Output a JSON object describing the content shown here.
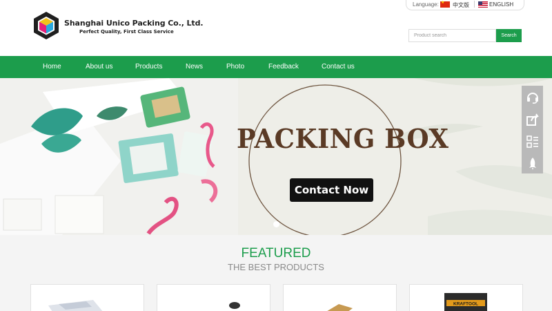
{
  "header": {
    "company_name": "Shanghai Unico Packing Co., Ltd.",
    "slogan": "Perfect Quality, First Class Service",
    "language_label": "Language:",
    "languages": [
      {
        "label": "中文版",
        "flag": "cn-flag-icon"
      },
      {
        "label": "ENGLISH",
        "flag": "us-flag-icon"
      }
    ],
    "search": {
      "placeholder": "Product search",
      "button_label": "Search"
    }
  },
  "nav": {
    "items": [
      {
        "label": "Home"
      },
      {
        "label": "About us"
      },
      {
        "label": "Products"
      },
      {
        "label": "News"
      },
      {
        "label": "Photo"
      },
      {
        "label": "Feedback"
      },
      {
        "label": "Contact us"
      }
    ]
  },
  "banner": {
    "headline": "PACKING BOX",
    "cta_label": "Contact Now"
  },
  "side_toolbar": {
    "buttons": [
      "headset-icon",
      "share-icon",
      "qr-code-icon",
      "rocket-icon"
    ]
  },
  "featured": {
    "title": "FEATURED",
    "subtitle": "THE BEST PRODUCTS",
    "card_count": 4,
    "card_labels": [
      "",
      "",
      "",
      "KRAFTOOL"
    ]
  },
  "colors": {
    "brand_green": "#1c9d4c",
    "headline_brown": "#5a3a25",
    "side_toolbar_gray": "#b9b9b9"
  }
}
